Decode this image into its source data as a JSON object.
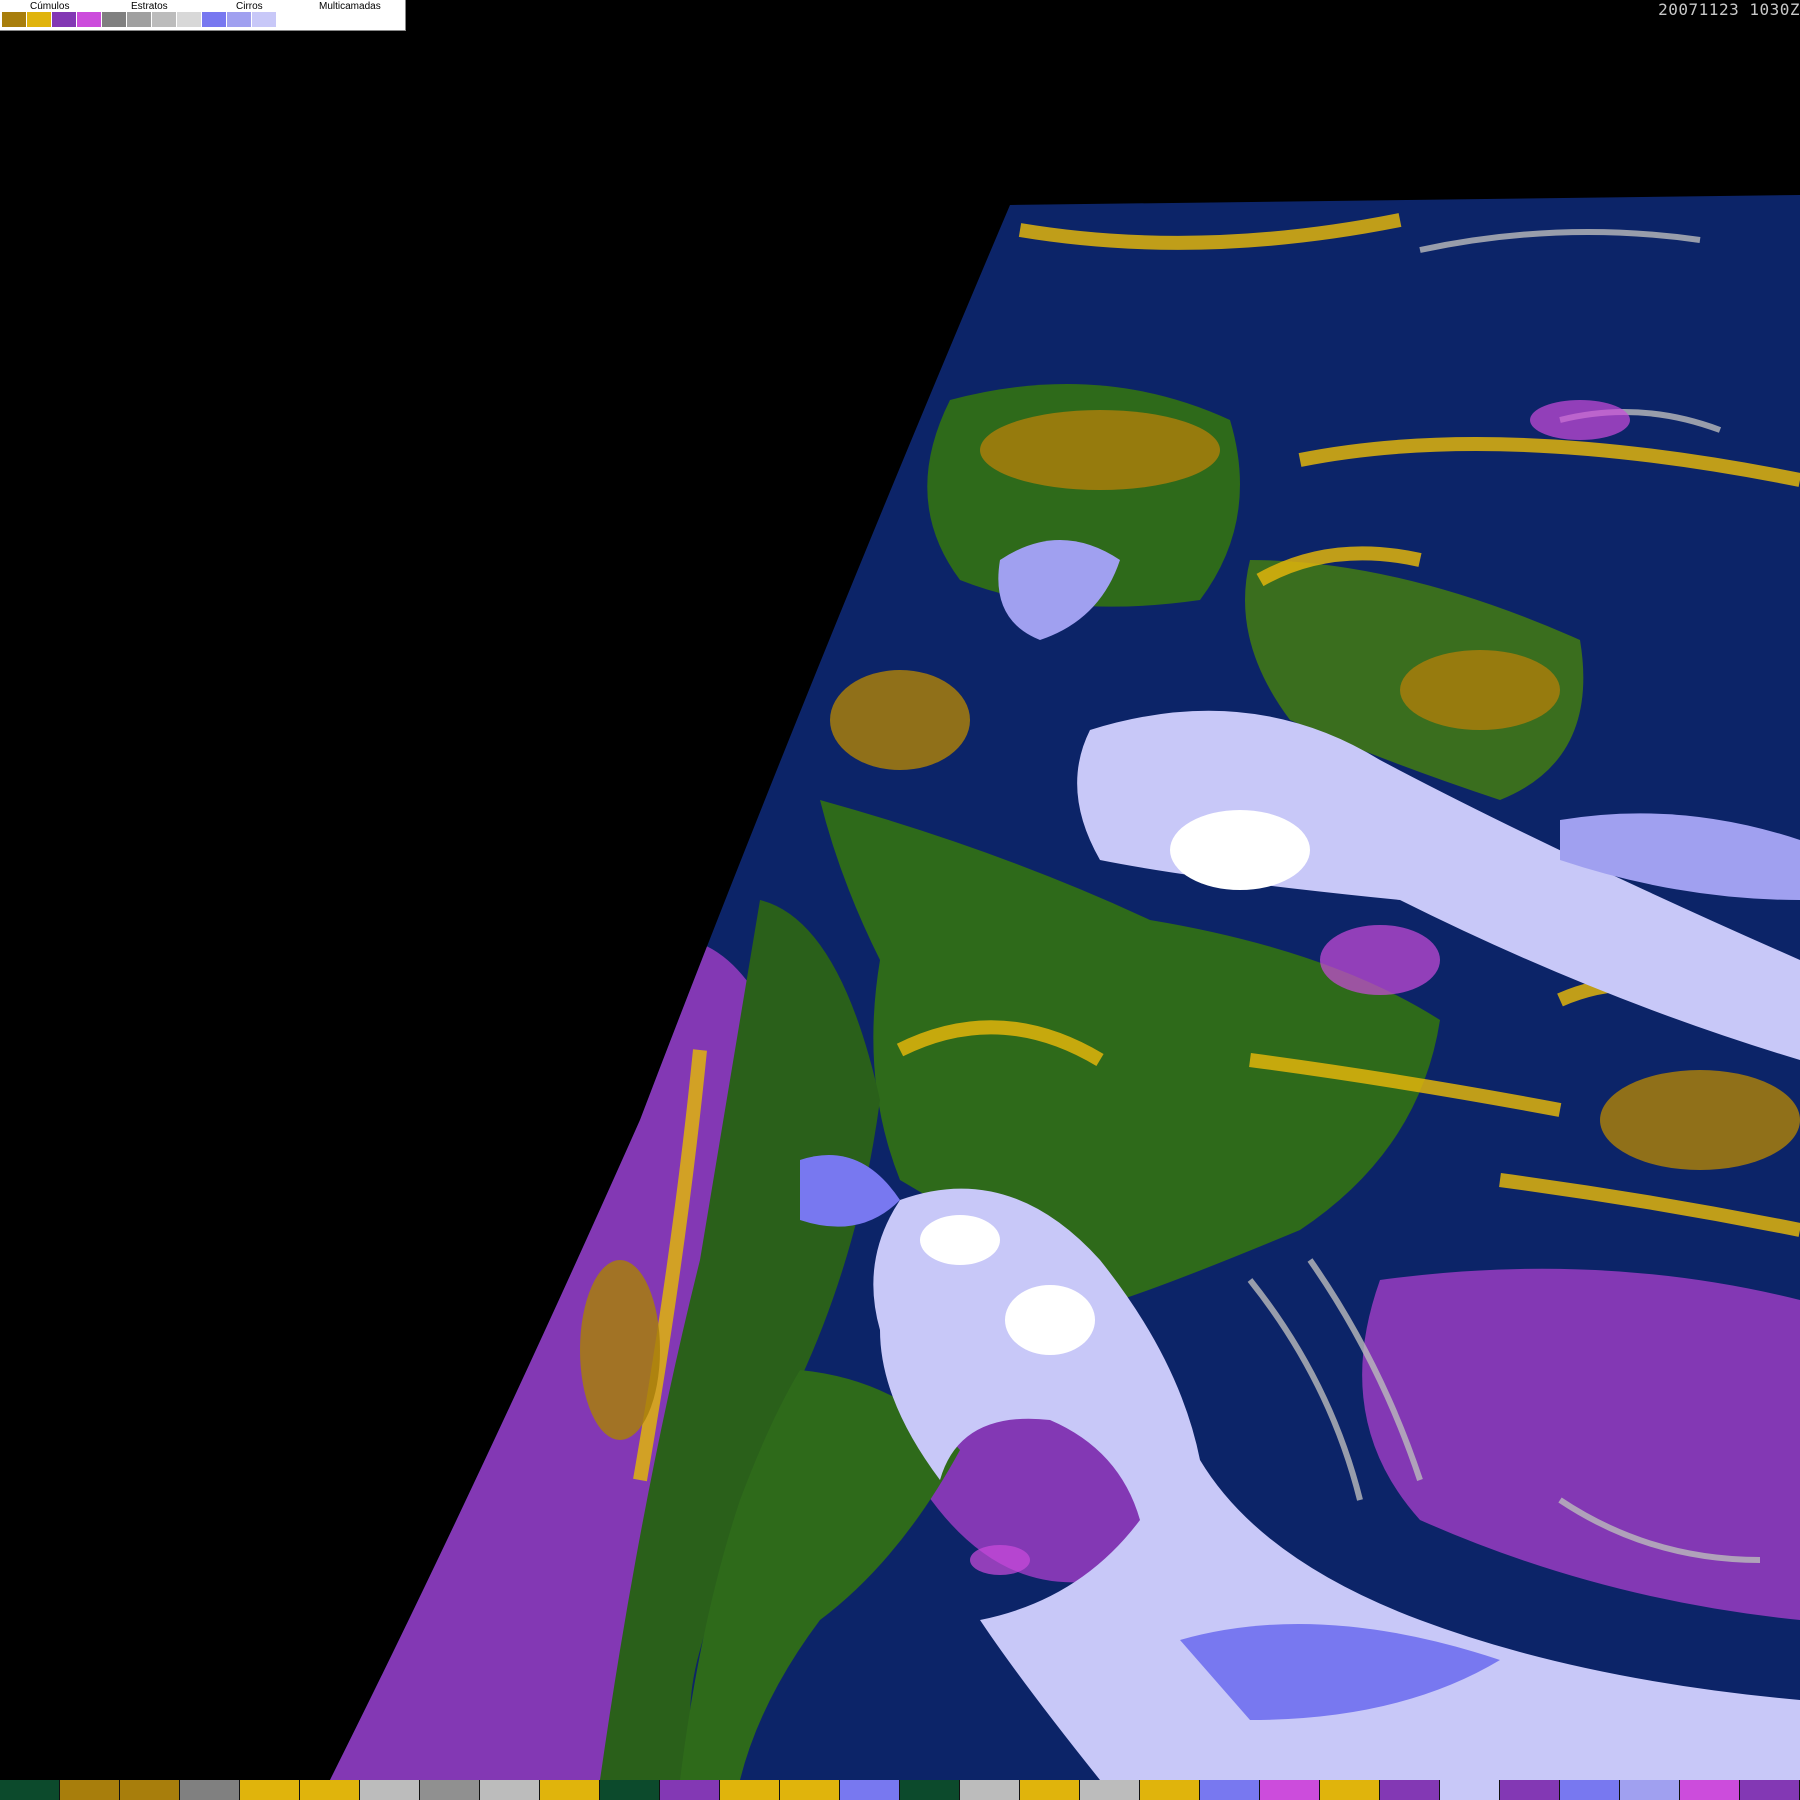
{
  "legend": {
    "groups": [
      {
        "label": "Cúmulos",
        "colors": [
          "#a87e0c",
          "#e0b40c"
        ]
      },
      {
        "label": "Estratos",
        "colors": [
          "#8338b4",
          "#cc4cdc"
        ]
      },
      {
        "label": "Cirros",
        "colors": [
          "#808080",
          "#a0a0a0",
          "#bcbcbc",
          "#d8d8d8"
        ]
      },
      {
        "label": "Multicamadas",
        "colors": [
          "#7878f0",
          "#a0a0f0",
          "#c8c8f8",
          "#ffffff"
        ]
      }
    ]
  },
  "timestamp": "20071123  1030Z",
  "colors": {
    "ocean": "#0c2468",
    "land": "#2e6a1a",
    "cumulus": "#e0b40c",
    "stratus": "#8338b4",
    "multilayer": "#c8c8f8"
  },
  "bottom_bar": {
    "colors": [
      "#0c4a2c",
      "#a87e0c",
      "#a87e0c",
      "#808080",
      "#e0b40c",
      "#e0b40c",
      "#bcbcbc",
      "#909090",
      "#bcbcbc",
      "#e0b40c",
      "#0c4a2c",
      "#8338b4",
      "#e0b40c",
      "#e0b40c",
      "#7878f0",
      "#0c4a2c",
      "#bcbcbc",
      "#e0b40c",
      "#bcbcbc",
      "#e0b40c",
      "#7878f0",
      "#cc4cdc",
      "#e0b40c",
      "#8338b4",
      "#c8c8f8",
      "#8338b4",
      "#7878f0",
      "#a0a0f0",
      "#cc4cdc",
      "#8338b4"
    ]
  }
}
